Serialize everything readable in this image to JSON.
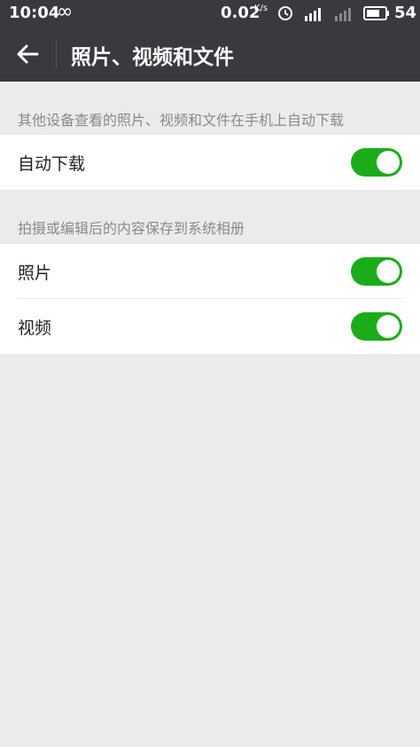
{
  "status_bar": {
    "time": "10:04",
    "speed_value": "0.02",
    "speed_unit": "K/s",
    "battery_level": "54",
    "icons": [
      "infinity-icon",
      "alarm-icon",
      "signal-4g-icon",
      "signal-icon",
      "battery-icon"
    ]
  },
  "header": {
    "title": "照片、视频和文件",
    "back_icon": "back-arrow-icon"
  },
  "section1": {
    "header": "其他设备查看的照片、视频和文件在手机上自动下载",
    "items": [
      {
        "label": "自动下载",
        "enabled": true
      }
    ]
  },
  "section2": {
    "header": "拍摄或编辑后的内容保存到系统相册",
    "items": [
      {
        "label": "照片",
        "enabled": true
      },
      {
        "label": "视频",
        "enabled": true
      }
    ]
  },
  "colors": {
    "toolbar": "#393a3f",
    "toggle_on": "#1aad19",
    "background": "#ebebeb"
  }
}
